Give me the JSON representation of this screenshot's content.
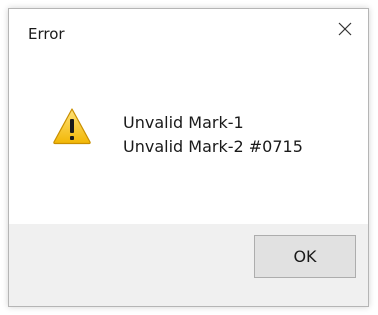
{
  "dialog": {
    "title": "Error",
    "close_icon": "close-icon",
    "icon": "warning-icon",
    "message_lines": [
      "Unvalid Mark-1",
      "Unvalid Mark-2 #0715"
    ],
    "ok_label": "OK"
  },
  "colors": {
    "footer_bg": "#f0f0f0",
    "button_bg": "#e1e1e1",
    "button_border": "#adadad",
    "warning_fill": "#f5c518"
  }
}
